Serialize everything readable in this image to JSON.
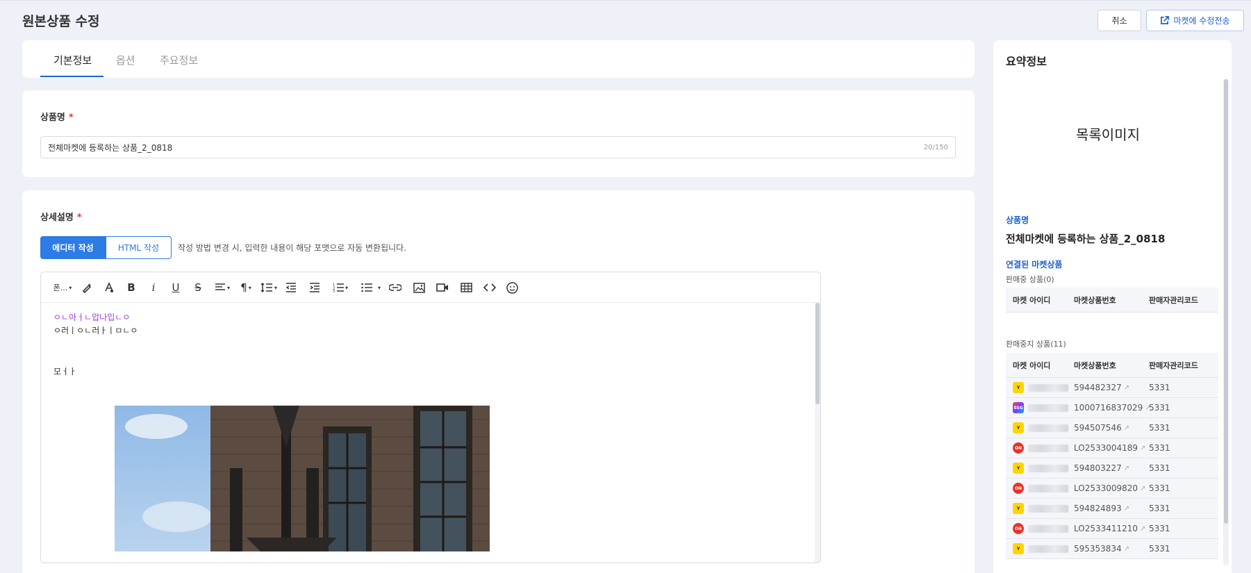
{
  "header": {
    "title": "원본상품 수정",
    "cancel_label": "취소",
    "send_label": "마켓에 수정전송"
  },
  "tabs": [
    {
      "label": "기본정보",
      "active": true
    },
    {
      "label": "옵션",
      "active": false
    },
    {
      "label": "주요정보",
      "active": false
    }
  ],
  "product_name": {
    "label": "상품명",
    "required_mark": "*",
    "value": "전체마켓에 등록하는 상품_2_0818",
    "counter": "20/150"
  },
  "description": {
    "label": "상세설명",
    "required_mark": "*",
    "mode_editor": "에디터 작성",
    "mode_html": "HTML 작성",
    "mode_note": "작성 방법 변경 시, 입력한 내용이 해당 포맷으로 자동 변환됩니다.",
    "font_select": "폰...",
    "content_lines": [
      "ㅇㄴ아ㅓㄴ압나입ㄴㅇ",
      "ㅇ러ㅣㅇㄴ러ㅏㅣㅁㄴㅇ",
      "모ㅓㅏ"
    ]
  },
  "summary": {
    "title": "요약정보",
    "list_image_label": "목록이미지",
    "product_name_label": "상품명",
    "product_name_value": "전체마켓에 등록하는 상품_2_0818",
    "linked_label": "연결된 마켓상품",
    "on_sale_label": "판매중 상품(0)",
    "stopped_label": "판매중지 상품(11)",
    "columns": [
      "마켓 아이디",
      "마켓상품번호",
      "판매자관리코드"
    ],
    "rows": [
      {
        "badge": "Y",
        "product_no": "594482327",
        "code": "5331"
      },
      {
        "badge": "SSG",
        "product_no": "1000716837029",
        "code": "5331"
      },
      {
        "badge": "Y",
        "product_no": "594507546",
        "code": "5331"
      },
      {
        "badge": "ON",
        "product_no": "LO2533004189",
        "code": "5331"
      },
      {
        "badge": "Y",
        "product_no": "594803227",
        "code": "5331"
      },
      {
        "badge": "ON",
        "product_no": "LO2533009820",
        "code": "5331"
      },
      {
        "badge": "Y",
        "product_no": "594824893",
        "code": "5331"
      },
      {
        "badge": "ON",
        "product_no": "LO2533411210",
        "code": "5331"
      },
      {
        "badge": "Y",
        "product_no": "595353834",
        "code": "5331"
      }
    ]
  },
  "colors": {
    "accent": "#2d7be5",
    "link": "#1d5fd1",
    "required": "#e53935",
    "background": "#eef1f8"
  }
}
